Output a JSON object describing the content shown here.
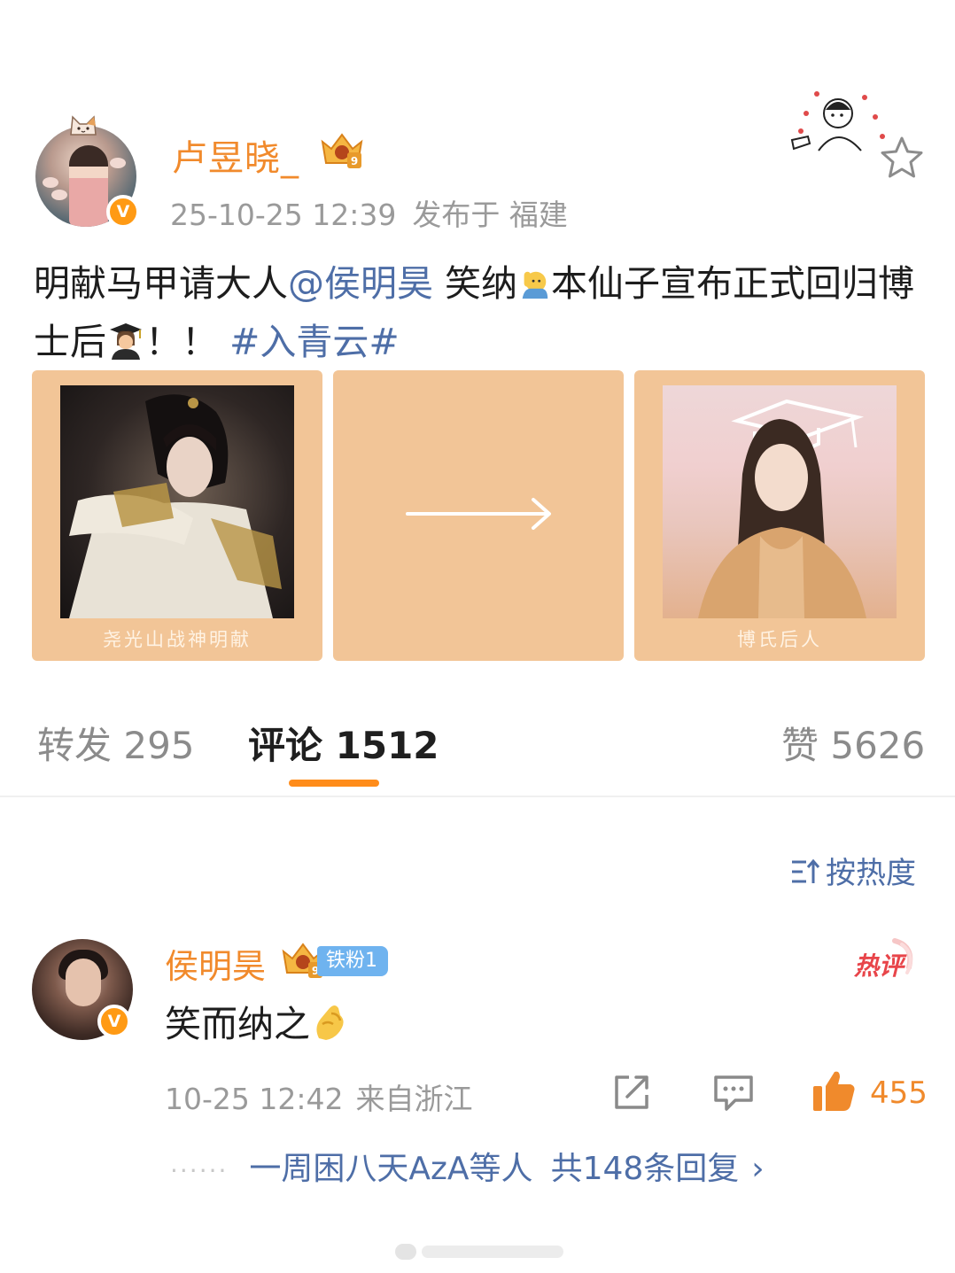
{
  "post": {
    "username": "卢昱晓_",
    "verified_glyph": "V",
    "crown_level": "9",
    "timestamp": "25-10-25 12:39",
    "location": "发布于 福建",
    "text_before_mention": "明献马甲请大人",
    "mention": "@侯明昊",
    "text_after_mention": " 笑纳",
    "text_middle": "本仙子宣布正式回归博士后",
    "text_exclaim": "！！",
    "topic": "#入青云#"
  },
  "images": [
    {
      "caption": "尧光山战神明献",
      "icon": "portrait-warrior"
    },
    {
      "caption": "",
      "icon": "arrow-right-icon"
    },
    {
      "caption": "博氏后人",
      "icon": "portrait-graduate"
    }
  ],
  "stats": {
    "repost_label": "转发 295",
    "comment_label": "评论 1512",
    "like_label": "赞 5626"
  },
  "sort": {
    "label": "按热度",
    "icon": "sort-icon"
  },
  "comment": {
    "username": "侯明昊",
    "crown_level": "9",
    "verified_glyph": "V",
    "fan_badge": "铁粉1",
    "hot_badge": "热评",
    "text": "笑而纳之",
    "timestamp": "10-25 12:42",
    "location": "来自浙江",
    "like_count": "455",
    "reply_dots": "······",
    "reply_users": "一周困八天AzA等人",
    "reply_count": "共148条回复",
    "reply_chevron": "›"
  },
  "colors": {
    "accent_orange": "#f18a2c",
    "link_blue": "#4e6ea7",
    "image_background": "#f2c597",
    "tab_underline": "#ff8c1a"
  }
}
